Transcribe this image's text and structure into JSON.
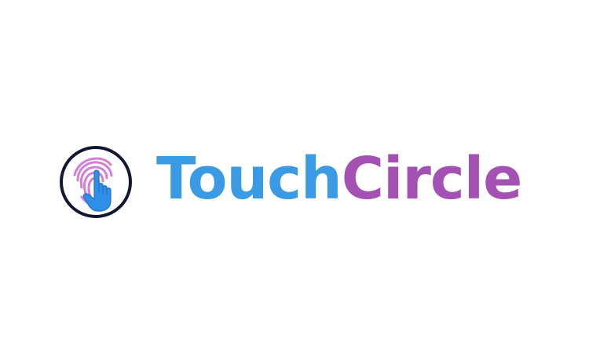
{
  "logo": {
    "word_primary": "Touch",
    "word_secondary": "Circle",
    "emblem_icon": "fingerprint-touch-icon"
  },
  "colors": {
    "background": "#ffffff",
    "primary_blue": "#3a9ae3",
    "secondary_purple": "#a352b4",
    "ring": "#141733",
    "fingerprint": "#d37fd6",
    "hand": "#2f8fe6"
  }
}
